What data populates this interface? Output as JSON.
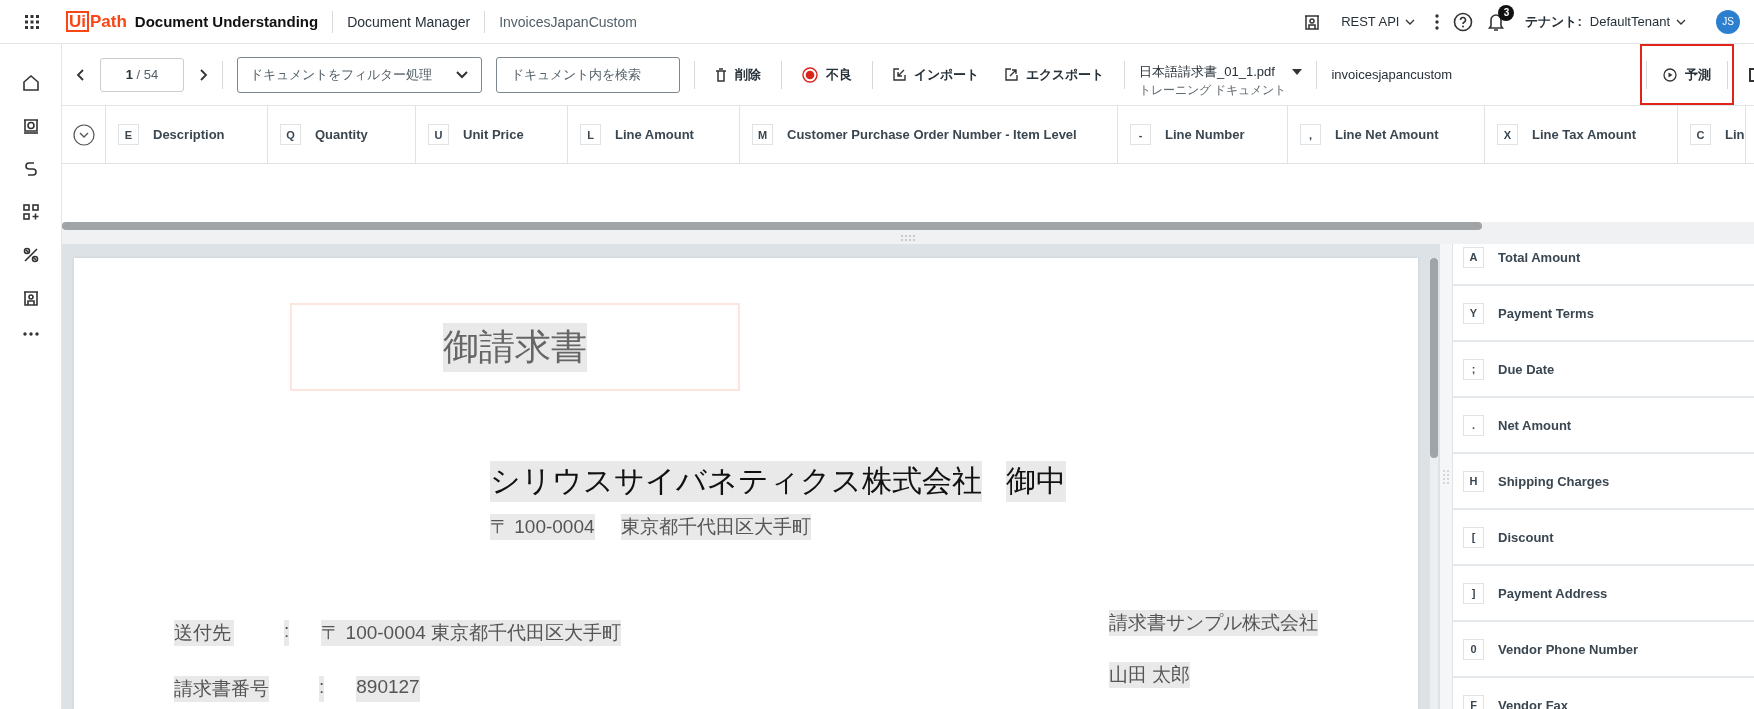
{
  "header": {
    "logo_mark": "Ui",
    "logo_text": "Path",
    "product": "Document Understanding",
    "breadcrumbs": [
      "Document Manager",
      "InvoicesJapanCustom"
    ],
    "api_menu": "REST API",
    "notifications": "3",
    "tenant_label": "テナント:",
    "tenant": "DefaultTenant",
    "avatar": "JS"
  },
  "toolbar": {
    "page_current": "1",
    "page_total": "/ 54",
    "filter": "ドキュメントをフィルター処理",
    "search": {
      "placeholder": "ドキュメント内を検索"
    },
    "actions": [
      {
        "kind": "delete",
        "label": "削除"
      },
      {
        "kind": "flag",
        "label": "不良"
      },
      {
        "kind": "import",
        "label": "インポート"
      },
      {
        "kind": "export",
        "label": "エクスポート"
      }
    ],
    "document": {
      "name": "日本語請求書_01_1.pdf",
      "type": "トレーニング ドキュメント"
    },
    "project": "invoicesjapancustom",
    "predict": {
      "label": "予測",
      "highlighted": true
    }
  },
  "table": {
    "columns": [
      {
        "key": "E",
        "label": "Description"
      },
      {
        "key": "Q",
        "label": "Quantity"
      },
      {
        "key": "U",
        "label": "Unit Price"
      },
      {
        "key": "L",
        "label": "Line Amount"
      },
      {
        "key": "M",
        "label": "Customer Purchase Order Number - Item Level"
      },
      {
        "key": "-",
        "label": "Line Number"
      },
      {
        "key": ",",
        "label": "Line Net Amount"
      },
      {
        "key": "X",
        "label": "Line Tax Amount"
      },
      {
        "key": "C",
        "label": "Lin"
      }
    ]
  },
  "document": {
    "title": "御請求書",
    "addressee": [
      "シリウスサイバネティクス株式会社",
      "御中"
    ],
    "address": [
      "〒 100-0004",
      "東京都千代田区大手町"
    ],
    "rows": [
      {
        "label": "送付先",
        "sep": ":",
        "value": "〒 100-0004 東京都千代田区大手町"
      },
      {
        "label": "請求書番号",
        "sep": ":",
        "value": "890127"
      }
    ],
    "sender": [
      "請求書サンプル株式会社",
      "山田 太郎"
    ]
  },
  "fields": [
    {
      "key": "A",
      "label": "Total Amount"
    },
    {
      "key": "Y",
      "label": "Payment Terms"
    },
    {
      "key": ";",
      "label": "Due Date"
    },
    {
      "key": ".",
      "label": "Net Amount"
    },
    {
      "key": "H",
      "label": "Shipping Charges"
    },
    {
      "key": "[",
      "label": "Discount"
    },
    {
      "key": "]",
      "label": "Payment Address"
    },
    {
      "key": "0",
      "label": "Vendor Phone Number"
    },
    {
      "key": "F",
      "label": "Vendor Fax"
    }
  ]
}
